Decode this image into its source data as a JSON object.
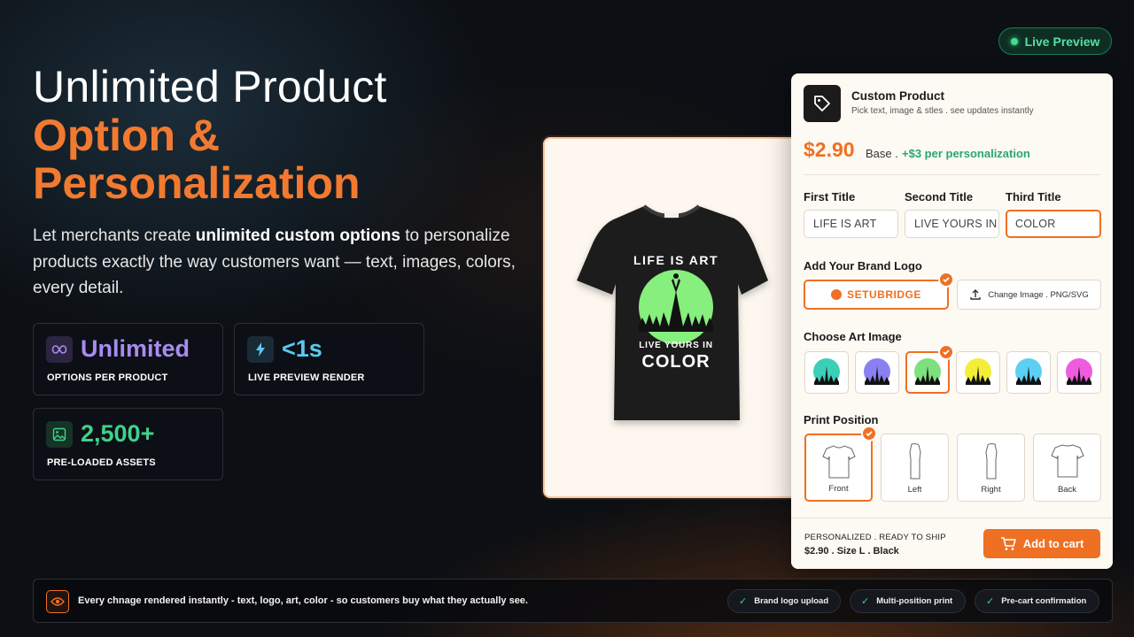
{
  "live_preview": {
    "label": "Live Preview"
  },
  "hero": {
    "title_line1": "Unlimited Product",
    "title_line2": "Option &",
    "title_line3": "Personalization",
    "desc_pre": "Let merchants create ",
    "desc_bold": "unlimited custom options",
    "desc_post": " to personalize products exactly the way customers want — text, images, colors, every detail."
  },
  "stats": [
    {
      "value": "Unlimited",
      "label": "OPTIONS PER PRODUCT",
      "icon": "infinity-icon",
      "color": "#a98bf0"
    },
    {
      "value": "<1s",
      "label": "LIVE PREVIEW RENDER",
      "icon": "lightning-icon",
      "color": "#5cc8f0"
    },
    {
      "value": "2,500+",
      "label": "PRE-LOADED ASSETS",
      "icon": "image-icon",
      "color": "#3fd28a"
    }
  ],
  "tshirt": {
    "tag": "SETUBRIDGE",
    "print_line1": "LIFE IS ART",
    "print_line2": "LIVE YOURS IN",
    "print_line3": "COLOR"
  },
  "panel": {
    "title": "Custom Product",
    "subtitle": "Pick text, image & stles . see updates instantly",
    "price": "$2.90",
    "base": "Base .",
    "extra": "+$3 per personalization",
    "fields": [
      {
        "label": "First Title",
        "value": "LIFE IS ART"
      },
      {
        "label": "Second Title",
        "value": "LIVE YOURS IN"
      },
      {
        "label": "Third Title",
        "value": "COLOR"
      }
    ],
    "logo_section": "Add Your Brand Logo",
    "logo_name": "SETUBRIDGE",
    "change_image": "Change Image . PNG/SVG",
    "art_section": "Choose Art Image",
    "art_colors": [
      "#3ccfb8",
      "#8a80f2",
      "#7ee07e",
      "#f2ee3a",
      "#5cd0f2",
      "#f05ce0"
    ],
    "position_section": "Print Position",
    "positions": [
      "Front",
      "Left",
      "Right",
      "Back"
    ],
    "footer_line1": "PERSONALIZED  .  READY TO SHIP",
    "footer_line2": "$2.90  .   Size  L  .   Black",
    "add_to_cart": "Add to cart"
  },
  "bottom_bar": {
    "text": "Every  chnage rendered instantly - text, logo, art, color - so customers buy what they actually see.",
    "chips": [
      "Brand logo upload",
      "Multi-position print",
      "Pre-cart confirmation"
    ]
  }
}
